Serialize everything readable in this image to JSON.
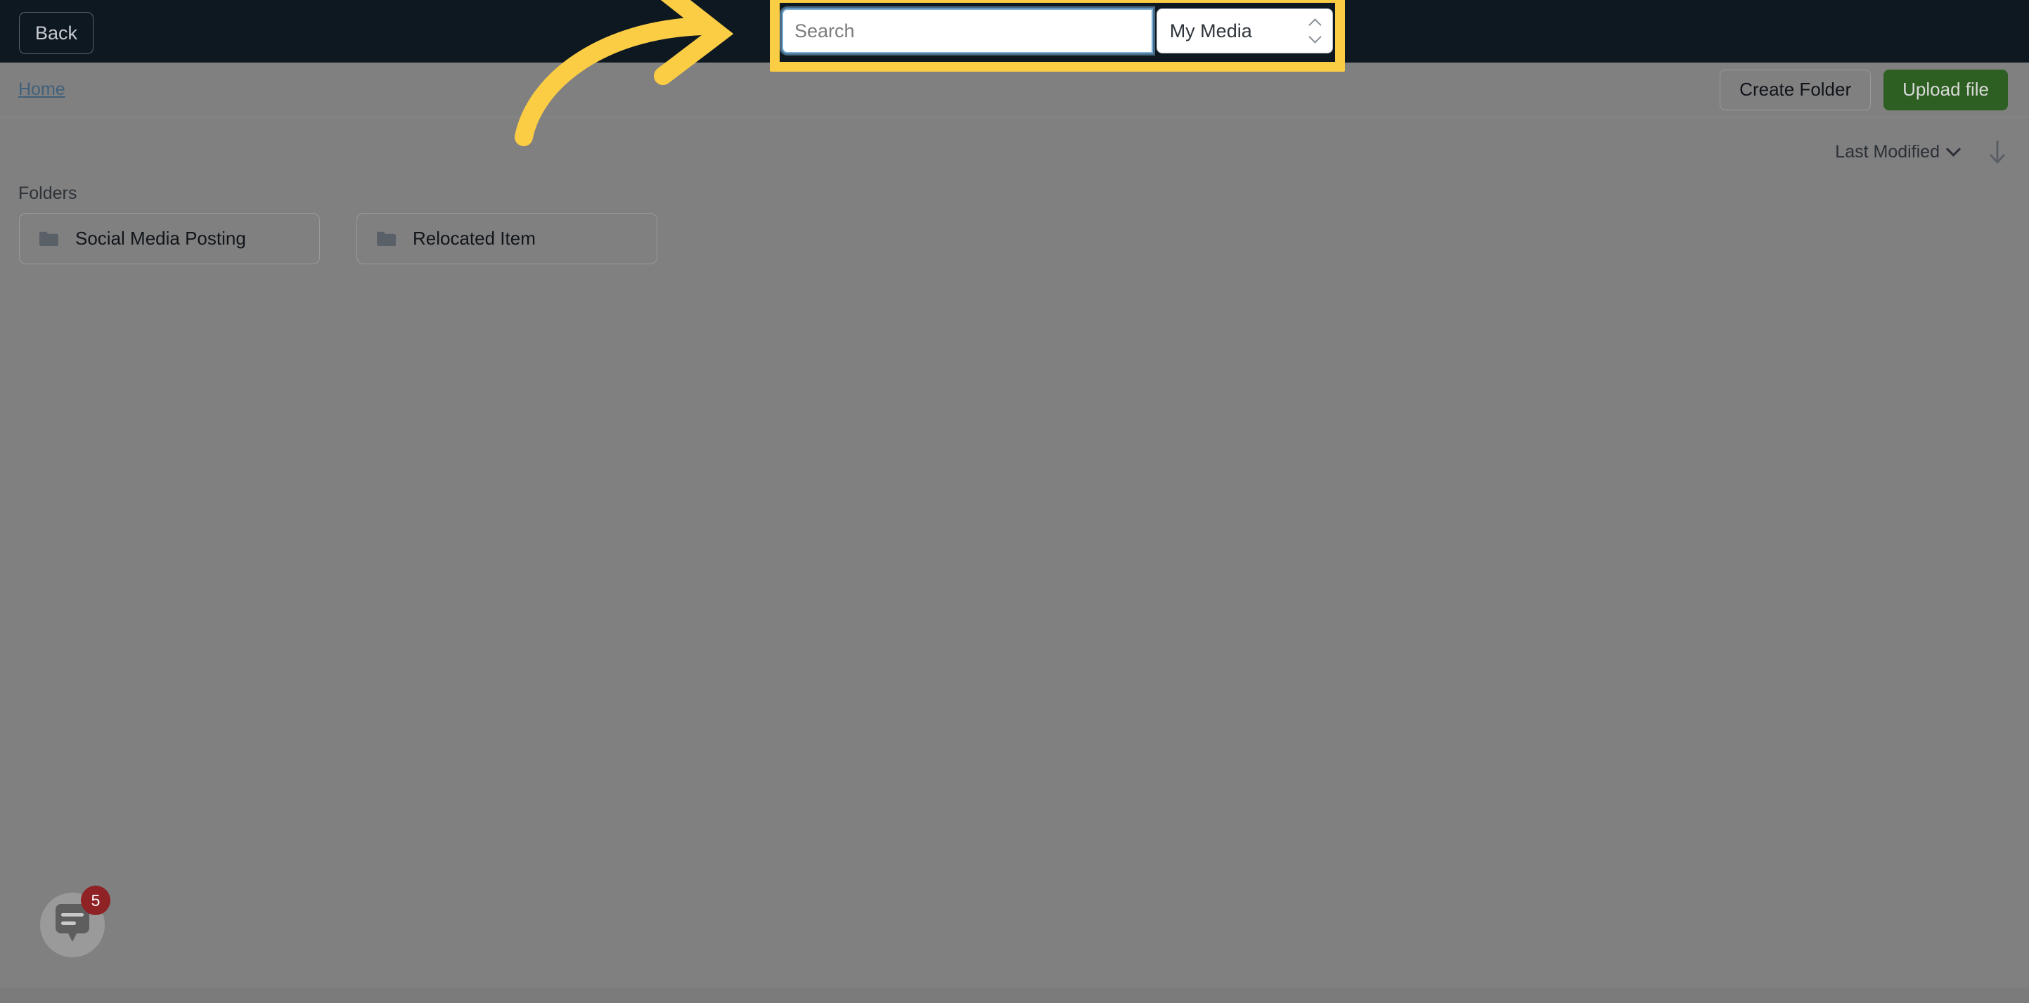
{
  "colors": {
    "topbar_bg": "#0e1821",
    "body_bg": "#808080",
    "highlight_yellow": "#fbcd45",
    "link_blue": "#41607b",
    "upload_green": "#2c5f21",
    "badge_red": "#8e2225",
    "focus_ring_blue": "#7aaed6"
  },
  "topbar": {
    "back_label": "Back"
  },
  "search": {
    "placeholder": "Search",
    "value": "",
    "scope_selected": "My Media",
    "scope_options": [
      "My Media"
    ]
  },
  "breadcrumb": {
    "items": [
      "Home"
    ],
    "home_label": "Home"
  },
  "actions": {
    "create_folder_label": "Create Folder",
    "upload_file_label": "Upload file"
  },
  "sort": {
    "field_label": "Last Modified",
    "direction_icon": "arrow-down-icon",
    "chevron_icon": "chevron-down-icon"
  },
  "folders": {
    "section_label": "Folders",
    "items": [
      {
        "name": "Social Media Posting",
        "icon": "folder-icon"
      },
      {
        "name": "Relocated Item",
        "icon": "folder-icon"
      }
    ]
  },
  "chat_widget": {
    "icon": "chat-bubble-icon",
    "badge_count": "5"
  },
  "annotation": {
    "arrow_icon": "curved-arrow-right-icon",
    "highlight_target": "search-cluster"
  }
}
